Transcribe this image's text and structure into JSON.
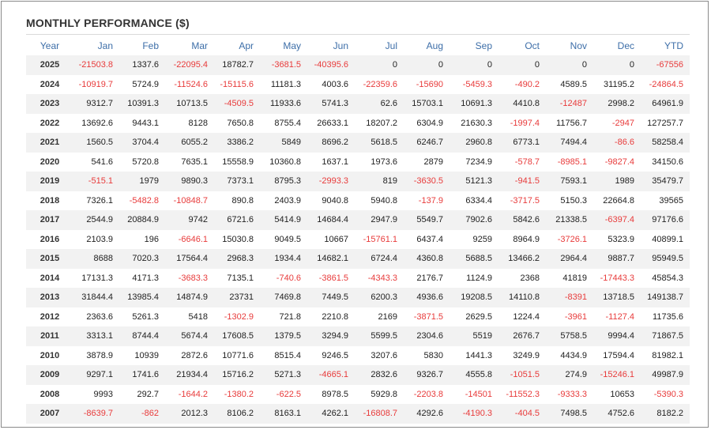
{
  "title": "MONTHLY PERFORMANCE ($)",
  "colors": {
    "header_text": "#3d6ea8",
    "negative": "#e83b3b",
    "stripe": "#f2f2f2"
  },
  "columns": [
    "Year",
    "Jan",
    "Feb",
    "Mar",
    "Apr",
    "May",
    "Jun",
    "Jul",
    "Aug",
    "Sep",
    "Oct",
    "Nov",
    "Dec",
    "YTD"
  ],
  "rows": [
    [
      "2025",
      "-21503.8",
      "1337.6",
      "-22095.4",
      "18782.7",
      "-3681.5",
      "-40395.6",
      "0",
      "0",
      "0",
      "0",
      "0",
      "0",
      "-67556"
    ],
    [
      "2024",
      "-10919.7",
      "5724.9",
      "-11524.6",
      "-15115.6",
      "11181.3",
      "4003.6",
      "-22359.6",
      "-15690",
      "-5459.3",
      "-490.2",
      "4589.5",
      "31195.2",
      "-24864.5"
    ],
    [
      "2023",
      "9312.7",
      "10391.3",
      "10713.5",
      "-4509.5",
      "11933.6",
      "5741.3",
      "62.6",
      "15703.1",
      "10691.3",
      "4410.8",
      "-12487",
      "2998.2",
      "64961.9"
    ],
    [
      "2022",
      "13692.6",
      "9443.1",
      "8128",
      "7650.8",
      "8755.4",
      "26633.1",
      "18207.2",
      "6304.9",
      "21630.3",
      "-1997.4",
      "11756.7",
      "-2947",
      "127257.7"
    ],
    [
      "2021",
      "1560.5",
      "3704.4",
      "6055.2",
      "3386.2",
      "5849",
      "8696.2",
      "5618.5",
      "6246.7",
      "2960.8",
      "6773.1",
      "7494.4",
      "-86.6",
      "58258.4"
    ],
    [
      "2020",
      "541.6",
      "5720.8",
      "7635.1",
      "15558.9",
      "10360.8",
      "1637.1",
      "1973.6",
      "2879",
      "7234.9",
      "-578.7",
      "-8985.1",
      "-9827.4",
      "34150.6"
    ],
    [
      "2019",
      "-515.1",
      "1979",
      "9890.3",
      "7373.1",
      "8795.3",
      "-2993.3",
      "819",
      "-3630.5",
      "5121.3",
      "-941.5",
      "7593.1",
      "1989",
      "35479.7"
    ],
    [
      "2018",
      "7326.1",
      "-5482.8",
      "-10848.7",
      "890.8",
      "2403.9",
      "9040.8",
      "5940.8",
      "-137.9",
      "6334.4",
      "-3717.5",
      "5150.3",
      "22664.8",
      "39565"
    ],
    [
      "2017",
      "2544.9",
      "20884.9",
      "9742",
      "6721.6",
      "5414.9",
      "14684.4",
      "2947.9",
      "5549.7",
      "7902.6",
      "5842.6",
      "21338.5",
      "-6397.4",
      "97176.6"
    ],
    [
      "2016",
      "2103.9",
      "196",
      "-6646.1",
      "15030.8",
      "9049.5",
      "10667",
      "-15761.1",
      "6437.4",
      "9259",
      "8964.9",
      "-3726.1",
      "5323.9",
      "40899.1"
    ],
    [
      "2015",
      "8688",
      "7020.3",
      "17564.4",
      "2968.3",
      "1934.4",
      "14682.1",
      "6724.4",
      "4360.8",
      "5688.5",
      "13466.2",
      "2964.4",
      "9887.7",
      "95949.5"
    ],
    [
      "2014",
      "17131.3",
      "4171.3",
      "-3683.3",
      "7135.1",
      "-740.6",
      "-3861.5",
      "-4343.3",
      "2176.7",
      "1124.9",
      "2368",
      "41819",
      "-17443.3",
      "45854.3"
    ],
    [
      "2013",
      "31844.4",
      "13985.4",
      "14874.9",
      "23731",
      "7469.8",
      "7449.5",
      "6200.3",
      "4936.6",
      "19208.5",
      "14110.8",
      "-8391",
      "13718.5",
      "149138.7"
    ],
    [
      "2012",
      "2363.6",
      "5261.3",
      "5418",
      "-1302.9",
      "721.8",
      "2210.8",
      "2169",
      "-3871.5",
      "2629.5",
      "1224.4",
      "-3961",
      "-1127.4",
      "11735.6"
    ],
    [
      "2011",
      "3313.1",
      "8744.4",
      "5674.4",
      "17608.5",
      "1379.5",
      "3294.9",
      "5599.5",
      "2304.6",
      "5519",
      "2676.7",
      "5758.5",
      "9994.4",
      "71867.5"
    ],
    [
      "2010",
      "3878.9",
      "10939",
      "2872.6",
      "10771.6",
      "8515.4",
      "9246.5",
      "3207.6",
      "5830",
      "1441.3",
      "3249.9",
      "4434.9",
      "17594.4",
      "81982.1"
    ],
    [
      "2009",
      "9297.1",
      "1741.6",
      "21934.4",
      "15716.2",
      "5271.3",
      "-4665.1",
      "2832.6",
      "9326.7",
      "4555.8",
      "-1051.5",
      "274.9",
      "-15246.1",
      "49987.9"
    ],
    [
      "2008",
      "9993",
      "292.7",
      "-1644.2",
      "-1380.2",
      "-622.5",
      "8978.5",
      "5929.8",
      "-2203.8",
      "-14501",
      "-11552.3",
      "-9333.3",
      "10653",
      "-5390.3"
    ],
    [
      "2007",
      "-8639.7",
      "-862",
      "2012.3",
      "8106.2",
      "8163.1",
      "4262.1",
      "-16808.7",
      "4292.6",
      "-4190.3",
      "-404.5",
      "7498.5",
      "4752.6",
      "8182.2"
    ]
  ]
}
